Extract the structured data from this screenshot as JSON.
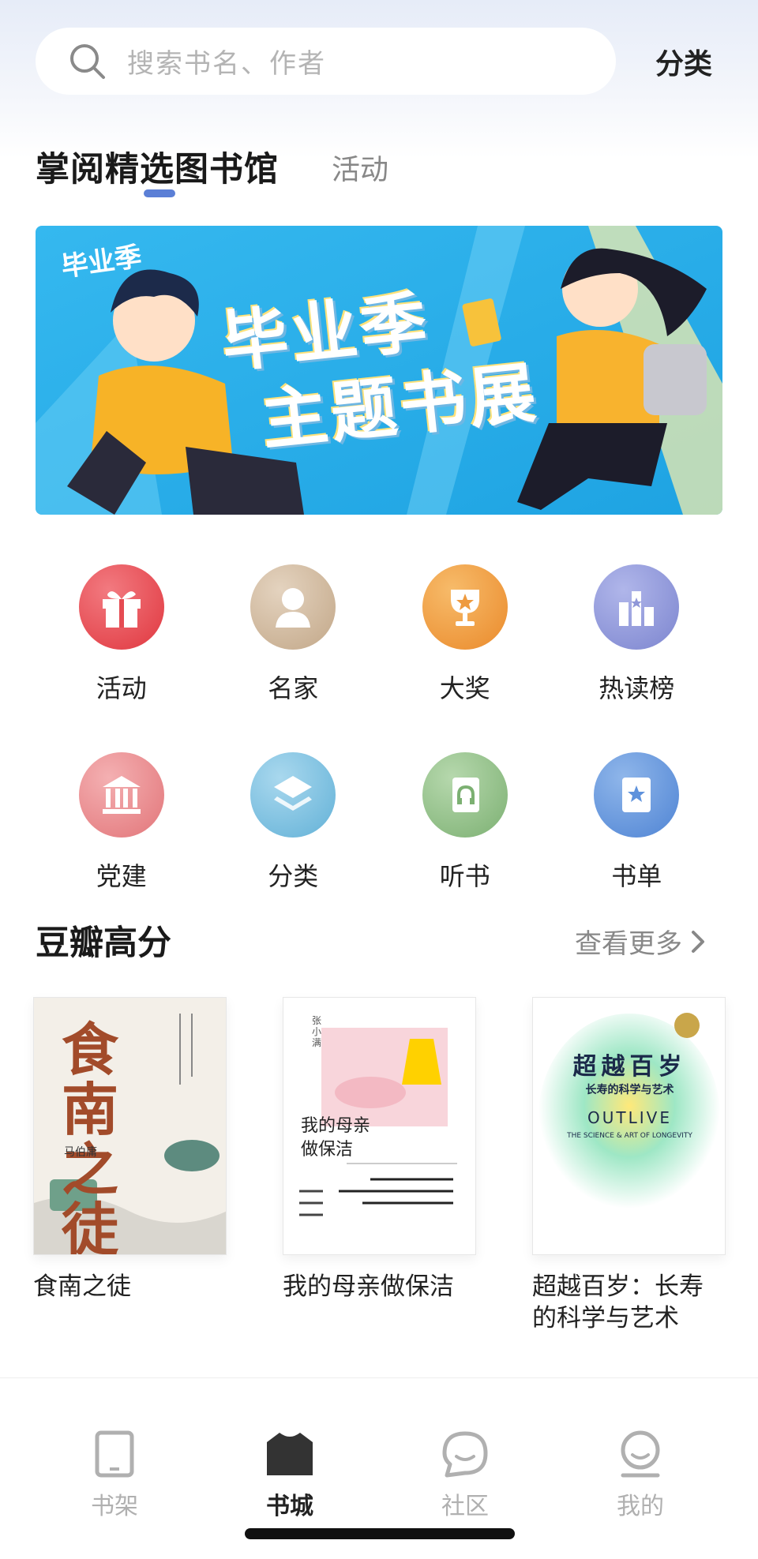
{
  "search": {
    "placeholder": "搜索书名、作者",
    "category_link": "分类"
  },
  "tabs": {
    "main": "掌阅精选图书馆",
    "second": "活动"
  },
  "banner": {
    "badge": "毕业季",
    "line1": "毕业季",
    "line2": "主题书展"
  },
  "categories": [
    {
      "label": "活动",
      "icon": "gift-icon",
      "color": "#e54b52"
    },
    {
      "label": "名家",
      "icon": "person-icon",
      "color": "#cdb59a"
    },
    {
      "label": "大奖",
      "icon": "trophy-icon",
      "color": "#ee9a3f"
    },
    {
      "label": "热读榜",
      "icon": "chart-icon",
      "color": "#8f97d8"
    },
    {
      "label": "党建",
      "icon": "building-icon",
      "color": "#e98a8d"
    },
    {
      "label": "分类",
      "icon": "layers-icon",
      "color": "#7ec0df"
    },
    {
      "label": "听书",
      "icon": "headphone-book-icon",
      "color": "#8fbf87"
    },
    {
      "label": "书单",
      "icon": "star-book-icon",
      "color": "#5e92dc"
    }
  ],
  "section": {
    "title": "豆瓣高分",
    "see_more": "查看更多"
  },
  "books": [
    {
      "title": "食南之徒",
      "cover_title": "食南之徒",
      "cover_author": "马伯庸"
    },
    {
      "title": "我的母亲做保洁",
      "cover_title": "我的母亲\n做保洁",
      "cover_author": "张小满"
    },
    {
      "title": "超越百岁：长寿的科学与艺术",
      "cover_title": "超越百岁",
      "cover_subtitle": "长寿的科学与艺术",
      "cover_en": "OUTLIVE",
      "cover_en_sub": "THE SCIENCE & ART OF LONGEVITY"
    }
  ],
  "nav": [
    {
      "label": "书架",
      "icon": "bookshelf-icon",
      "active": false
    },
    {
      "label": "书城",
      "icon": "store-icon",
      "active": true
    },
    {
      "label": "社区",
      "icon": "chat-icon",
      "active": false
    },
    {
      "label": "我的",
      "icon": "profile-icon",
      "active": false
    }
  ],
  "colors": {
    "accent": "#5b7fd6",
    "banner_bg": "#2fb2ea"
  }
}
